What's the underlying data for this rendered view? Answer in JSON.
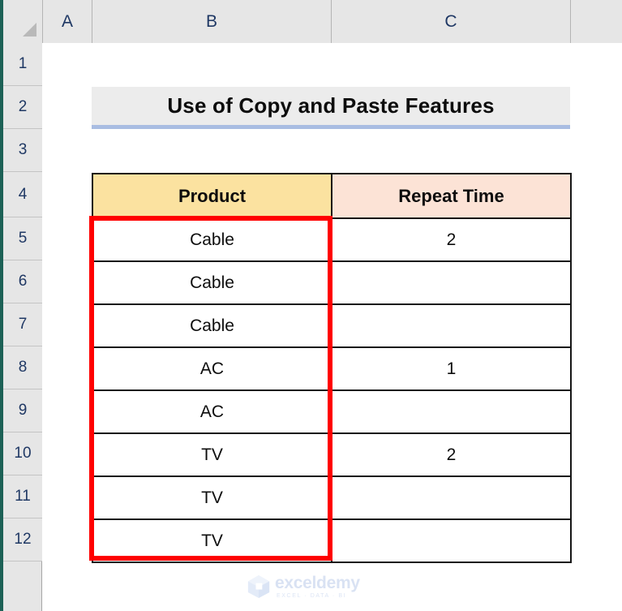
{
  "app": {
    "type": "spreadsheet",
    "corner_icon": "select-all-triangle-icon"
  },
  "grid": {
    "column_headers": [
      "A",
      "B",
      "C"
    ],
    "row_headers": [
      "1",
      "2",
      "3",
      "4",
      "5",
      "6",
      "7",
      "8",
      "9",
      "10",
      "11",
      "12"
    ]
  },
  "title_cell": {
    "text": "Use of Copy and Paste Features",
    "cell_ref": "B2",
    "background": "#ececec",
    "underline_color": "#a9bde2"
  },
  "table": {
    "header_cell_ref": "B4",
    "columns": [
      {
        "label": "Product",
        "background": "#fbe2a0"
      },
      {
        "label": "Repeat Time",
        "background": "#fce3d6"
      }
    ],
    "rows": [
      {
        "product": "Cable",
        "repeat_time": "2"
      },
      {
        "product": "Cable",
        "repeat_time": ""
      },
      {
        "product": "Cable",
        "repeat_time": ""
      },
      {
        "product": "AC",
        "repeat_time": "1"
      },
      {
        "product": "AC",
        "repeat_time": ""
      },
      {
        "product": "TV",
        "repeat_time": "2"
      },
      {
        "product": "TV",
        "repeat_time": ""
      },
      {
        "product": "TV",
        "repeat_time": ""
      }
    ]
  },
  "selection": {
    "range": "B5:B12",
    "border_color": "#ff0000"
  },
  "watermark": {
    "name": "exceldemy",
    "tagline": "EXCEL · DATA · BI",
    "color": "#d9e2f3"
  }
}
